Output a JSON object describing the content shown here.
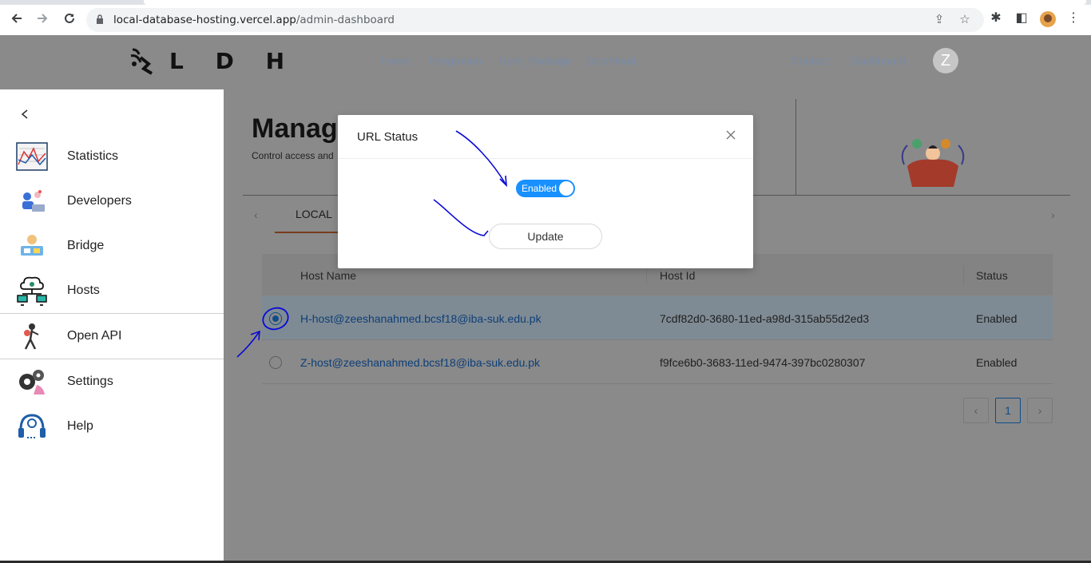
{
  "browser": {
    "url_host": "local-database-hosting.vercel.app",
    "url_path": "/admin-dashboard"
  },
  "site": {
    "logo_text": "L D H",
    "nav": [
      "Home",
      "Integration",
      "Npm_Package",
      "Download"
    ],
    "nav_right": [
      "Contact",
      "Dashboard"
    ],
    "avatar_letter": "Z"
  },
  "sidebar": {
    "items": [
      {
        "label": "Statistics",
        "icon": "statistics-icon"
      },
      {
        "label": "Developers",
        "icon": "developers-icon"
      },
      {
        "label": "Bridge",
        "icon": "bridge-icon"
      },
      {
        "label": "Hosts",
        "icon": "hosts-icon"
      },
      {
        "label": "Open API",
        "icon": "open-api-icon"
      },
      {
        "label": "Settings",
        "icon": "settings-icon"
      },
      {
        "label": "Help",
        "icon": "help-icon"
      }
    ]
  },
  "main": {
    "title": "Manage",
    "subtitle": "Control access and",
    "tab_label": "LOCAL"
  },
  "table": {
    "headers": [
      "Host Name",
      "Host Id",
      "Status"
    ],
    "rows": [
      {
        "host_name": "H-host@zeeshanahmed.bcsf18@iba-suk.edu.pk",
        "host_id": "7cdf82d0-3680-11ed-a98d-315ab55d2ed3",
        "status": "Enabled",
        "selected": true
      },
      {
        "host_name": "Z-host@zeeshanahmed.bcsf18@iba-suk.edu.pk",
        "host_id": "f9fce6b0-3683-11ed-9474-397bc0280307",
        "status": "Enabled",
        "selected": false
      }
    ]
  },
  "pagination": {
    "current": "1"
  },
  "modal": {
    "title": "URL Status",
    "switch_label": "Enabled",
    "update_label": "Update"
  },
  "colors": {
    "accent": "#1890ff",
    "annotation": "#0a0ad6"
  }
}
